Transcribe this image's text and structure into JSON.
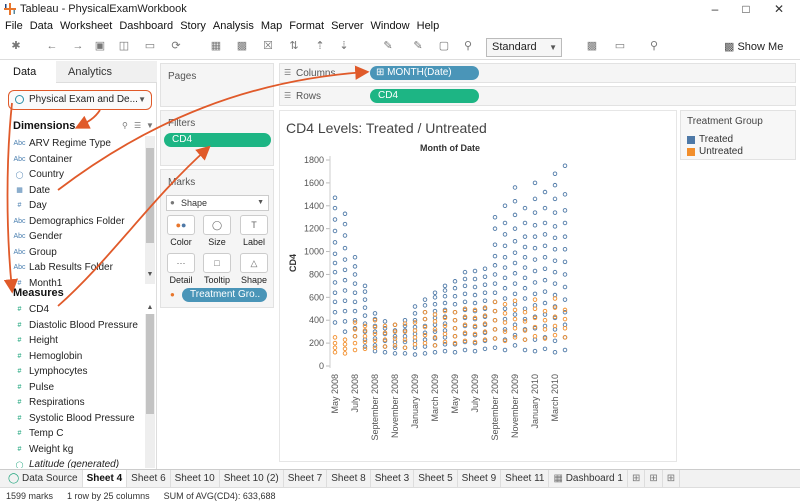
{
  "window": {
    "title": "Tableau - PhysicalExamWorkbook"
  },
  "menu": [
    "File",
    "Data",
    "Worksheet",
    "Dashboard",
    "Story",
    "Analysis",
    "Map",
    "Format",
    "Server",
    "Window",
    "Help"
  ],
  "toolbar": {
    "fit_mode": "Standard",
    "show_me_label": "Show Me"
  },
  "data_pane": {
    "tab_data": "Data",
    "tab_analytics": "Analytics",
    "datasource": "Physical Exam and De...",
    "dimensions_title": "Dimensions",
    "dimensions": [
      {
        "name": "ARV Regime Type",
        "type": "Abc"
      },
      {
        "name": "Container",
        "type": "Abc"
      },
      {
        "name": "Country",
        "type": "geo"
      },
      {
        "name": "Date",
        "type": "date"
      },
      {
        "name": "Day",
        "type": "#"
      },
      {
        "name": "Demographics Folder",
        "type": "Abc"
      },
      {
        "name": "Gender",
        "type": "Abc"
      },
      {
        "name": "Group",
        "type": "Abc"
      },
      {
        "name": "Lab Results Folder",
        "type": "Abc"
      },
      {
        "name": "Month1",
        "type": "#"
      }
    ],
    "measures_title": "Measures",
    "measures": [
      {
        "name": "CD4",
        "type": "#"
      },
      {
        "name": "Diastolic Blood Pressure",
        "type": "#"
      },
      {
        "name": "Height",
        "type": "#"
      },
      {
        "name": "Hemoglobin",
        "type": "#"
      },
      {
        "name": "Lymphocytes",
        "type": "#"
      },
      {
        "name": "Pulse",
        "type": "#"
      },
      {
        "name": "Respirations",
        "type": "#"
      },
      {
        "name": "Systolic Blood Pressure",
        "type": "#"
      },
      {
        "name": "Temp C",
        "type": "#"
      },
      {
        "name": "Weight kg",
        "type": "#"
      },
      {
        "name": "Latitude (generated)",
        "type": "geo",
        "italic": true
      }
    ]
  },
  "shelves": {
    "pages_label": "Pages",
    "filters_label": "Filters",
    "filter_pill": "CD4",
    "marks_label": "Marks",
    "mark_type": "Shape",
    "mark_buttons": [
      "Color",
      "Size",
      "Label",
      "Detail",
      "Tooltip",
      "Shape"
    ],
    "mark_pill": "Treatment Gro..",
    "columns_label": "Columns",
    "columns_pill": "MONTH(Date)",
    "rows_label": "Rows",
    "rows_pill": "CD4"
  },
  "legend": {
    "title": "Treatment Group",
    "items": [
      {
        "name": "Treated",
        "color": "#4e79a7"
      },
      {
        "name": "Untreated",
        "color": "#f28e2b"
      }
    ]
  },
  "chart_data": {
    "type": "scatter",
    "title": "CD4 Levels: Treated / Untreated",
    "xlabel": "Month of Date",
    "ylabel": "CD4",
    "ylim": [
      0,
      1800
    ],
    "yticks": [
      0,
      200,
      400,
      600,
      800,
      1000,
      1200,
      1400,
      1600,
      1800
    ],
    "x_tick_labels": [
      "May 2008",
      "July 2008",
      "September 2008",
      "November 2008",
      "January 2009",
      "March 2009",
      "May 2009",
      "July 2009",
      "September 2009",
      "November 2009",
      "January 2010",
      "March 2010"
    ],
    "grid": false,
    "legend_position": "right",
    "series": [
      {
        "name": "Treated",
        "color": "#4e79a7",
        "columns": [
          {
            "x": "May 2008",
            "values": [
              380,
              470,
              560,
              640,
              730,
              820,
              900,
              980,
              1080,
              1180,
              1280,
              1380,
              1470
            ]
          },
          {
            "x": "Jun 2008",
            "values": [
              300,
              390,
              480,
              570,
              660,
              750,
              840,
              930,
              1030,
              1140,
              1240,
              1330
            ]
          },
          {
            "x": "Jul 2008",
            "values": [
              260,
              330,
              400,
              480,
              560,
              640,
              720,
              800,
              870,
              950
            ]
          },
          {
            "x": "Aug 2008",
            "values": [
              170,
              230,
              300,
              370,
              440,
              510,
              580,
              650,
              700
            ]
          },
          {
            "x": "Sep 2008",
            "values": [
              130,
              180,
              240,
              300,
              350,
              410,
              460
            ]
          },
          {
            "x": "Oct 2008",
            "values": [
              120,
              170,
              220,
              280,
              330,
              390
            ]
          },
          {
            "x": "Nov 2008",
            "values": [
              110,
              160,
              210,
              260,
              310,
              360
            ]
          },
          {
            "x": "Dec 2008",
            "values": [
              110,
              160,
              210,
              260,
              310,
              350,
              400
            ]
          },
          {
            "x": "Jan 2009",
            "values": [
              100,
              160,
              220,
              280,
              340,
              400,
              460,
              520
            ]
          },
          {
            "x": "Feb 2009",
            "values": [
              110,
              170,
              230,
              290,
              350,
              410,
              470,
              530,
              580
            ]
          },
          {
            "x": "Mar 2009",
            "values": [
              120,
              180,
              240,
              300,
              360,
              420,
              480,
              540,
              600,
              640
            ]
          },
          {
            "x": "Apr 2009",
            "values": [
              130,
              190,
              250,
              310,
              370,
              430,
              490,
              550,
              610,
              660,
              700
            ]
          },
          {
            "x": "May 2009",
            "values": [
              120,
              190,
              260,
              330,
              400,
              470,
              540,
              610,
              680,
              740
            ]
          },
          {
            "x": "Jun 2009",
            "values": [
              140,
              210,
              280,
              350,
              420,
              490,
              560,
              630,
              700,
              760,
              820
            ]
          },
          {
            "x": "Jul 2009",
            "values": [
              130,
              200,
              270,
              340,
              410,
              480,
              550,
              620,
              690,
              760,
              830
            ]
          },
          {
            "x": "Aug 2009",
            "values": [
              150,
              220,
              290,
              360,
              430,
              500,
              570,
              640,
              710,
              780,
              850
            ]
          },
          {
            "x": "Sep 2009",
            "values": [
              160,
              240,
              320,
              400,
              480,
              560,
              640,
              720,
              800,
              880,
              960,
              1060,
              1200,
              1300
            ]
          },
          {
            "x": "Oct 2009",
            "values": [
              140,
              230,
              320,
              410,
              500,
              590,
              680,
              770,
              860,
              950,
              1050,
              1150,
              1250,
              1400
            ]
          },
          {
            "x": "Nov 2009",
            "values": [
              180,
              270,
              360,
              450,
              540,
              630,
              720,
              810,
              900,
              990,
              1090,
              1200,
              1320,
              1440,
              1560
            ]
          },
          {
            "x": "Dec 2009",
            "values": [
              140,
              230,
              320,
              410,
              500,
              590,
              680,
              770,
              860,
              950,
              1040,
              1130,
              1250,
              1380
            ]
          },
          {
            "x": "Jan 2010",
            "values": [
              130,
              230,
              330,
              430,
              530,
              630,
              730,
              830,
              930,
              1030,
              1130,
              1230,
              1340,
              1460,
              1600
            ]
          },
          {
            "x": "Feb 2010",
            "values": [
              150,
              250,
              350,
              450,
              550,
              650,
              750,
              850,
              950,
              1050,
              1150,
              1250,
              1380,
              1520
            ]
          },
          {
            "x": "Mar 2010",
            "values": [
              120,
              220,
              320,
              420,
              520,
              620,
              720,
              820,
              920,
              1020,
              1120,
              1220,
              1340,
              1460,
              1580,
              1680
            ]
          },
          {
            "x": "Apr 2010",
            "values": [
              140,
              250,
              360,
              470,
              580,
              690,
              800,
              910,
              1020,
              1130,
              1250,
              1360,
              1500,
              1750
            ]
          }
        ]
      },
      {
        "name": "Untreated",
        "color": "#f28e2b",
        "columns": [
          {
            "x": "May 2008",
            "values": [
              120,
              160,
              200,
              250
            ]
          },
          {
            "x": "Jun 2008",
            "values": [
              110,
              150,
              190,
              230
            ]
          },
          {
            "x": "Jul 2008",
            "values": [
              140,
              200,
              260,
              320,
              380
            ]
          },
          {
            "x": "Aug 2008",
            "values": [
              150,
              210,
              260,
              310,
              350
            ]
          },
          {
            "x": "Sep 2008",
            "values": [
              160,
              220,
              280,
              340,
              400
            ]
          },
          {
            "x": "Oct 2008",
            "values": [
              170,
              230,
              290,
              350
            ]
          },
          {
            "x": "Nov 2008",
            "values": [
              180,
              240,
              300,
              360
            ]
          },
          {
            "x": "Dec 2008",
            "values": [
              160,
              230,
              300,
              370
            ]
          },
          {
            "x": "Jan 2009",
            "values": [
              190,
              250,
              310,
              380
            ]
          },
          {
            "x": "Feb 2009",
            "values": [
              200,
              270,
              340,
              410,
              470
            ]
          },
          {
            "x": "Mar 2009",
            "values": [
              180,
              250,
              320,
              390,
              450
            ]
          },
          {
            "x": "Apr 2009",
            "values": [
              210,
              280,
              350,
              420,
              480
            ]
          },
          {
            "x": "May 2009",
            "values": [
              200,
              260,
              330,
              400,
              470
            ]
          },
          {
            "x": "Jun 2009",
            "values": [
              220,
              290,
              360,
              430,
              500
            ]
          },
          {
            "x": "Jul 2009",
            "values": [
              210,
              280,
              350,
              420,
              490
            ]
          },
          {
            "x": "Aug 2009",
            "values": [
              230,
              300,
              370,
              440,
              510
            ]
          },
          {
            "x": "Sep 2009",
            "values": [
              240,
              320,
              400,
              480,
              560
            ]
          },
          {
            "x": "Oct 2009",
            "values": [
              220,
              300,
              380,
              460,
              540
            ]
          },
          {
            "x": "Nov 2009",
            "values": [
              250,
              330,
              410,
              490,
              570
            ]
          },
          {
            "x": "Dec 2009",
            "values": [
              230,
              310,
              390,
              470
            ]
          },
          {
            "x": "Jan 2010",
            "values": [
              260,
              340,
              420,
              500,
              580
            ]
          },
          {
            "x": "Feb 2010",
            "values": [
              240,
              320,
              400,
              480
            ]
          },
          {
            "x": "Mar 2010",
            "values": [
              270,
              350,
              430,
              510,
              590
            ]
          },
          {
            "x": "Apr 2010",
            "values": [
              250,
              330,
              410,
              490
            ]
          }
        ]
      }
    ]
  },
  "sheet_tabs": [
    "Data Source",
    "Sheet 4",
    "Sheet 6",
    "Sheet 10",
    "Sheet 10 (2)",
    "Sheet 7",
    "Sheet 8",
    "Sheet 3",
    "Sheet 5",
    "Sheet 9",
    "Sheet 11",
    "Dashboard 1"
  ],
  "active_sheet": "Sheet 4",
  "status": {
    "marks": "1599 marks",
    "rows": "1 row by 25 columns",
    "sum": "SUM of AVG(CD4): 633,688"
  },
  "annotation_color": "#e05a2a"
}
